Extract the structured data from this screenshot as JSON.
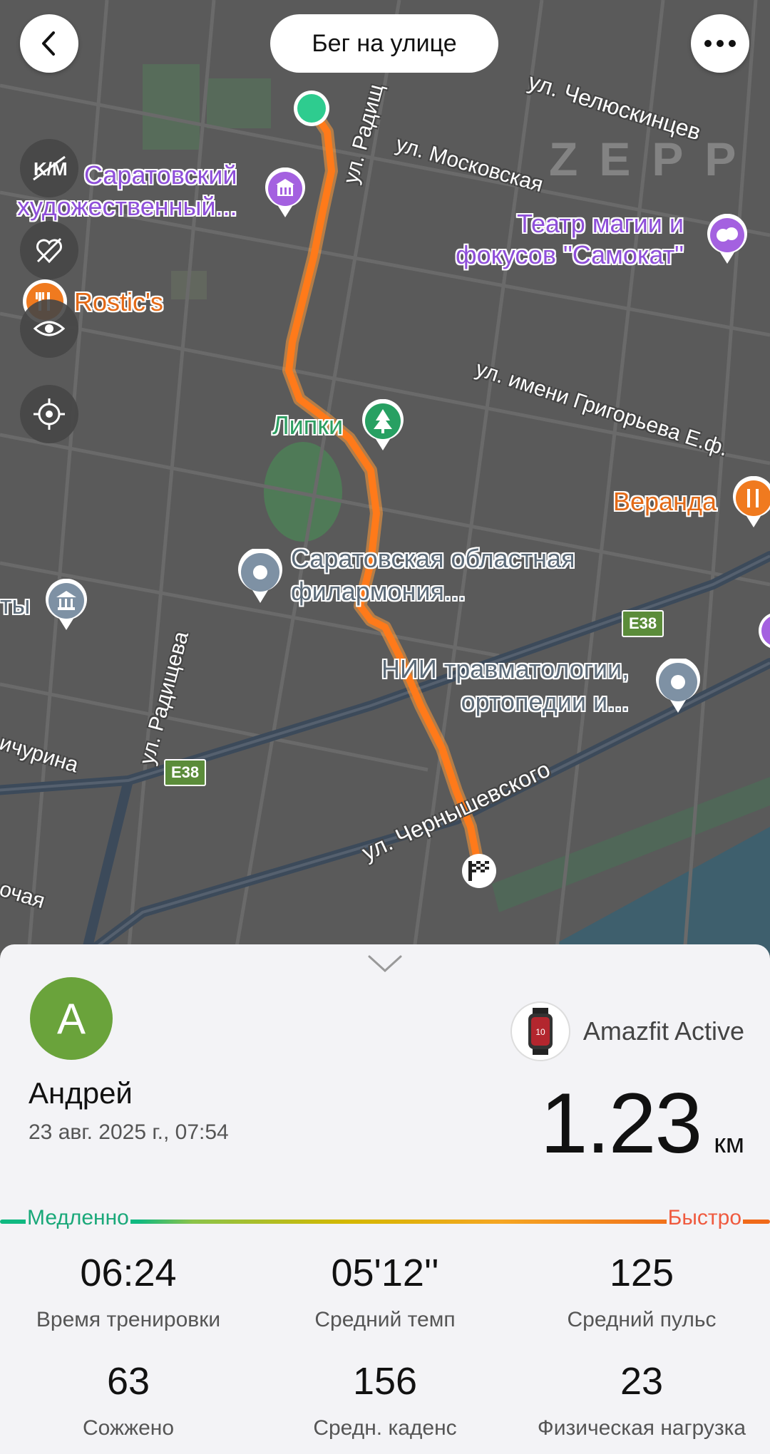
{
  "header": {
    "title": "Бег на улице"
  },
  "map": {
    "watermark": "ZEPP",
    "pois": [
      {
        "name": "Саратовский",
        "name2": "художественный...",
        "color": "purple",
        "icon": "museum-icon"
      },
      {
        "name": "Театр магии и",
        "name2": "фокусов \"Самокат\"",
        "color": "purple",
        "icon": "theater-icon"
      },
      {
        "name": "Rostic's",
        "color": "orange",
        "icon": "restaurant-icon"
      },
      {
        "name": "Липки",
        "color": "green",
        "icon": "park-icon"
      },
      {
        "name": "Веранда",
        "color": "orange",
        "icon": "restaurant-icon"
      },
      {
        "name": "Саратовская областная",
        "name2": "филармония...",
        "color": "gray",
        "icon": "place-icon"
      },
      {
        "name": "НИИ травматологии,",
        "name2": "ортопедии и...",
        "color": "gray",
        "icon": "place-icon"
      },
      {
        "name": "ты",
        "color": "gray",
        "icon": "bank-icon"
      }
    ],
    "streets": [
      "ул. Челюскинцев",
      "ул. Московская",
      "ул. Радищ",
      "ул. имени Григорьева Е.ф.",
      "ул. Радищева",
      "ичурина",
      "ул. Чернышевского",
      "очая"
    ],
    "road_badges": [
      "E38",
      "E38"
    ]
  },
  "summary": {
    "avatar_letter": "A",
    "user_name": "Андрей",
    "date": "23 авг. 2025 г., 07:54",
    "device_name": "Amazfit Active",
    "distance_value": "1.23",
    "distance_unit": "км",
    "speed_slow_label": "Медленно",
    "speed_fast_label": "Быстро"
  },
  "stats": [
    {
      "value": "06:24",
      "label": "Время тренировки"
    },
    {
      "value": "05'12''",
      "label": "Средний темп"
    },
    {
      "value": "125",
      "label": "Средний пульс"
    },
    {
      "value": "63",
      "label": "Сожжено"
    },
    {
      "value": "156",
      "label": "Средн. каденс"
    },
    {
      "value": "23",
      "label": "Физическая нагрузка"
    }
  ],
  "colors": {
    "route": "#ff7a1a",
    "start": "#2ecc8f",
    "avatar": "#6aa33b"
  }
}
